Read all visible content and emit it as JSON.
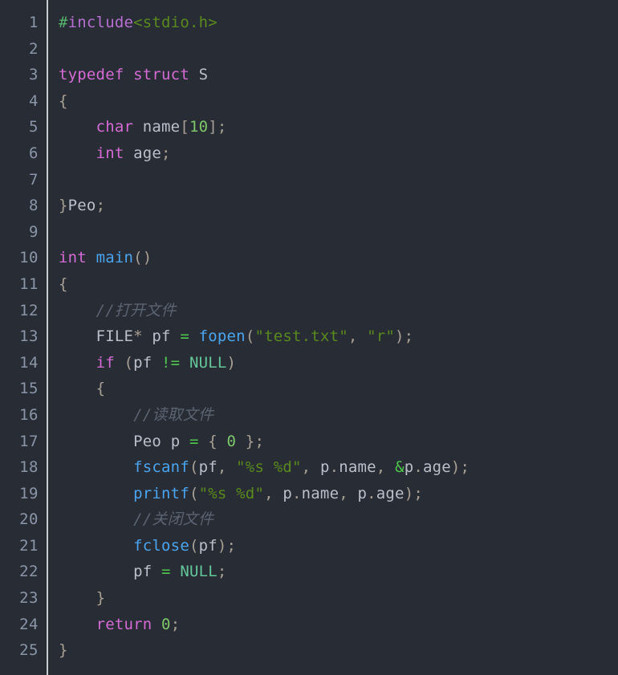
{
  "editor": {
    "name": "code-editor",
    "language": "C",
    "total_lines": 25,
    "theme": {
      "background": "#282c34",
      "gutter_text": "#8a96a8",
      "divider": "#c8ccd2",
      "default_text": "#b9c0cc",
      "keyword": "#d56bd5",
      "function": "#4aa5f0",
      "string": "#5a8a1e",
      "number": "#7ec76a",
      "operator": "#4ec94e",
      "punctuation": "#a8a094",
      "constant": "#63c79a",
      "comment": "#5a6472",
      "preprocessor_hash": "#55b36b",
      "preprocessor_name": "#b86fd4"
    }
  },
  "lines": [
    {
      "number": "1",
      "tokens": [
        {
          "t": "#",
          "c": "tok-pp"
        },
        {
          "t": "include",
          "c": "tok-ppname"
        },
        {
          "t": "<stdio.h>",
          "c": "tok-header"
        }
      ]
    },
    {
      "number": "2",
      "tokens": []
    },
    {
      "number": "3",
      "tokens": [
        {
          "t": "typedef",
          "c": "tok-kw"
        },
        {
          "t": " ",
          "c": "tok-ident"
        },
        {
          "t": "struct",
          "c": "tok-kw"
        },
        {
          "t": " ",
          "c": "tok-ident"
        },
        {
          "t": "S",
          "c": "tok-type"
        }
      ]
    },
    {
      "number": "4",
      "tokens": [
        {
          "t": "{",
          "c": "tok-punc"
        }
      ]
    },
    {
      "number": "5",
      "tokens": [
        {
          "t": "    ",
          "c": "tok-ident"
        },
        {
          "t": "char",
          "c": "tok-kw"
        },
        {
          "t": " ",
          "c": "tok-ident"
        },
        {
          "t": "name",
          "c": "tok-ident"
        },
        {
          "t": "[",
          "c": "tok-punc"
        },
        {
          "t": "10",
          "c": "tok-num"
        },
        {
          "t": "];",
          "c": "tok-punc"
        }
      ]
    },
    {
      "number": "6",
      "tokens": [
        {
          "t": "    ",
          "c": "tok-ident"
        },
        {
          "t": "int",
          "c": "tok-kw"
        },
        {
          "t": " ",
          "c": "tok-ident"
        },
        {
          "t": "age",
          "c": "tok-ident"
        },
        {
          "t": ";",
          "c": "tok-punc"
        }
      ]
    },
    {
      "number": "7",
      "tokens": []
    },
    {
      "number": "8",
      "tokens": [
        {
          "t": "}",
          "c": "tok-punc"
        },
        {
          "t": "Peo",
          "c": "tok-ident"
        },
        {
          "t": ";",
          "c": "tok-punc"
        }
      ]
    },
    {
      "number": "9",
      "tokens": []
    },
    {
      "number": "10",
      "tokens": [
        {
          "t": "int",
          "c": "tok-kw"
        },
        {
          "t": " ",
          "c": "tok-ident"
        },
        {
          "t": "main",
          "c": "tok-fn"
        },
        {
          "t": "()",
          "c": "tok-punc"
        }
      ]
    },
    {
      "number": "11",
      "tokens": [
        {
          "t": "{",
          "c": "tok-punc"
        }
      ]
    },
    {
      "number": "12",
      "tokens": [
        {
          "t": "    ",
          "c": "tok-ident"
        },
        {
          "t": "//打开文件",
          "c": "tok-comment"
        }
      ]
    },
    {
      "number": "13",
      "tokens": [
        {
          "t": "    ",
          "c": "tok-ident"
        },
        {
          "t": "FILE",
          "c": "tok-type"
        },
        {
          "t": "*",
          "c": "tok-punc"
        },
        {
          "t": " ",
          "c": "tok-ident"
        },
        {
          "t": "pf",
          "c": "tok-ident"
        },
        {
          "t": " ",
          "c": "tok-ident"
        },
        {
          "t": "=",
          "c": "tok-op"
        },
        {
          "t": " ",
          "c": "tok-ident"
        },
        {
          "t": "fopen",
          "c": "tok-fn"
        },
        {
          "t": "(",
          "c": "tok-punc"
        },
        {
          "t": "\"test.txt\"",
          "c": "tok-str"
        },
        {
          "t": ", ",
          "c": "tok-punc"
        },
        {
          "t": "\"r\"",
          "c": "tok-str"
        },
        {
          "t": ");",
          "c": "tok-punc"
        }
      ]
    },
    {
      "number": "14",
      "tokens": [
        {
          "t": "    ",
          "c": "tok-ident"
        },
        {
          "t": "if",
          "c": "tok-kw"
        },
        {
          "t": " ",
          "c": "tok-ident"
        },
        {
          "t": "(",
          "c": "tok-punc"
        },
        {
          "t": "pf",
          "c": "tok-ident"
        },
        {
          "t": " ",
          "c": "tok-ident"
        },
        {
          "t": "!=",
          "c": "tok-op"
        },
        {
          "t": " ",
          "c": "tok-ident"
        },
        {
          "t": "NULL",
          "c": "tok-const"
        },
        {
          "t": ")",
          "c": "tok-punc"
        }
      ]
    },
    {
      "number": "15",
      "tokens": [
        {
          "t": "    ",
          "c": "tok-ident"
        },
        {
          "t": "{",
          "c": "tok-punc"
        }
      ]
    },
    {
      "number": "16",
      "tokens": [
        {
          "t": "        ",
          "c": "tok-ident"
        },
        {
          "t": "//读取文件",
          "c": "tok-comment"
        }
      ]
    },
    {
      "number": "17",
      "tokens": [
        {
          "t": "        ",
          "c": "tok-ident"
        },
        {
          "t": "Peo",
          "c": "tok-type"
        },
        {
          "t": " ",
          "c": "tok-ident"
        },
        {
          "t": "p",
          "c": "tok-ident"
        },
        {
          "t": " ",
          "c": "tok-ident"
        },
        {
          "t": "=",
          "c": "tok-op"
        },
        {
          "t": " ",
          "c": "tok-ident"
        },
        {
          "t": "{ ",
          "c": "tok-punc"
        },
        {
          "t": "0",
          "c": "tok-num"
        },
        {
          "t": " };",
          "c": "tok-punc"
        }
      ]
    },
    {
      "number": "18",
      "tokens": [
        {
          "t": "        ",
          "c": "tok-ident"
        },
        {
          "t": "fscanf",
          "c": "tok-fn"
        },
        {
          "t": "(",
          "c": "tok-punc"
        },
        {
          "t": "pf",
          "c": "tok-ident"
        },
        {
          "t": ", ",
          "c": "tok-punc"
        },
        {
          "t": "\"%s %d\"",
          "c": "tok-str"
        },
        {
          "t": ", ",
          "c": "tok-punc"
        },
        {
          "t": "p",
          "c": "tok-ident"
        },
        {
          "t": ".",
          "c": "tok-punc"
        },
        {
          "t": "name",
          "c": "tok-ident"
        },
        {
          "t": ", ",
          "c": "tok-punc"
        },
        {
          "t": "&",
          "c": "tok-op"
        },
        {
          "t": "p",
          "c": "tok-ident"
        },
        {
          "t": ".",
          "c": "tok-punc"
        },
        {
          "t": "age",
          "c": "tok-ident"
        },
        {
          "t": ");",
          "c": "tok-punc"
        }
      ]
    },
    {
      "number": "19",
      "tokens": [
        {
          "t": "        ",
          "c": "tok-ident"
        },
        {
          "t": "printf",
          "c": "tok-fn"
        },
        {
          "t": "(",
          "c": "tok-punc"
        },
        {
          "t": "\"%s %d\"",
          "c": "tok-str"
        },
        {
          "t": ", ",
          "c": "tok-punc"
        },
        {
          "t": "p",
          "c": "tok-ident"
        },
        {
          "t": ".",
          "c": "tok-punc"
        },
        {
          "t": "name",
          "c": "tok-ident"
        },
        {
          "t": ", ",
          "c": "tok-punc"
        },
        {
          "t": "p",
          "c": "tok-ident"
        },
        {
          "t": ".",
          "c": "tok-punc"
        },
        {
          "t": "age",
          "c": "tok-ident"
        },
        {
          "t": ");",
          "c": "tok-punc"
        }
      ]
    },
    {
      "number": "20",
      "tokens": [
        {
          "t": "        ",
          "c": "tok-ident"
        },
        {
          "t": "//关闭文件",
          "c": "tok-comment"
        }
      ]
    },
    {
      "number": "21",
      "tokens": [
        {
          "t": "        ",
          "c": "tok-ident"
        },
        {
          "t": "fclose",
          "c": "tok-fn"
        },
        {
          "t": "(",
          "c": "tok-punc"
        },
        {
          "t": "pf",
          "c": "tok-ident"
        },
        {
          "t": ");",
          "c": "tok-punc"
        }
      ]
    },
    {
      "number": "22",
      "tokens": [
        {
          "t": "        ",
          "c": "tok-ident"
        },
        {
          "t": "pf",
          "c": "tok-ident"
        },
        {
          "t": " ",
          "c": "tok-ident"
        },
        {
          "t": "=",
          "c": "tok-op"
        },
        {
          "t": " ",
          "c": "tok-ident"
        },
        {
          "t": "NULL",
          "c": "tok-const"
        },
        {
          "t": ";",
          "c": "tok-punc"
        }
      ]
    },
    {
      "number": "23",
      "tokens": [
        {
          "t": "    ",
          "c": "tok-ident"
        },
        {
          "t": "}",
          "c": "tok-punc"
        }
      ]
    },
    {
      "number": "24",
      "tokens": [
        {
          "t": "    ",
          "c": "tok-ident"
        },
        {
          "t": "return",
          "c": "tok-kw"
        },
        {
          "t": " ",
          "c": "tok-ident"
        },
        {
          "t": "0",
          "c": "tok-num"
        },
        {
          "t": ";",
          "c": "tok-punc"
        }
      ]
    },
    {
      "number": "25",
      "tokens": [
        {
          "t": "}",
          "c": "tok-punc"
        }
      ]
    }
  ]
}
